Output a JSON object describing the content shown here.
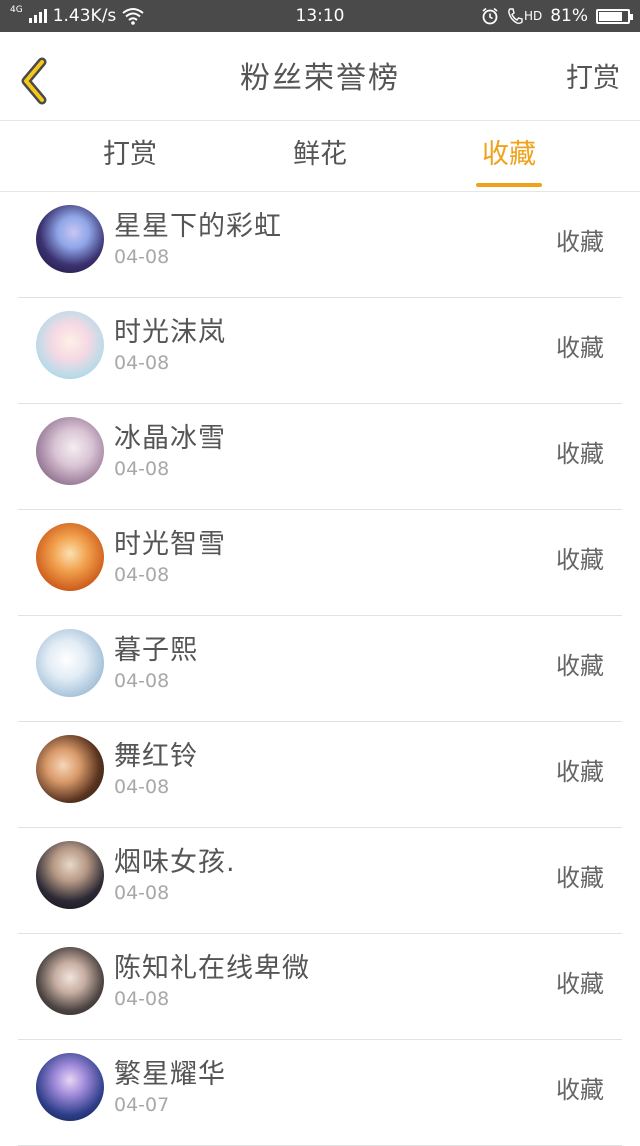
{
  "status_bar": {
    "network": "4G",
    "speed": "1.43K/s",
    "time": "13:10",
    "hd": "HD",
    "battery_percent": "81%",
    "battery_level": 0.81
  },
  "header": {
    "title": "粉丝荣誉榜",
    "action_label": "打赏",
    "back_icon": "chevron-left-icon"
  },
  "tabs": [
    {
      "label": "打赏",
      "active": false
    },
    {
      "label": "鲜花",
      "active": false
    },
    {
      "label": "收藏",
      "active": true
    }
  ],
  "accent_color": "#f0a21a",
  "list": [
    {
      "name": "星星下的彩虹",
      "date": "04-08",
      "action": "收藏"
    },
    {
      "name": "时光沫岚",
      "date": "04-08",
      "action": "收藏"
    },
    {
      "name": "冰晶冰雪",
      "date": "04-08",
      "action": "收藏"
    },
    {
      "name": "时光智雪",
      "date": "04-08",
      "action": "收藏"
    },
    {
      "name": "暮子熙",
      "date": "04-08",
      "action": "收藏"
    },
    {
      "name": "舞红铃",
      "date": "04-08",
      "action": "收藏"
    },
    {
      "name": "烟味女孩.",
      "date": "04-08",
      "action": "收藏"
    },
    {
      "name": "陈知礼在线卑微",
      "date": "04-08",
      "action": "收藏"
    },
    {
      "name": "繁星耀华",
      "date": "04-07",
      "action": "收藏"
    }
  ]
}
